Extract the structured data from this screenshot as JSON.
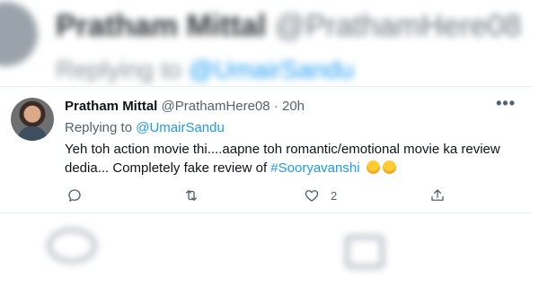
{
  "background_tweet": {
    "name": "Pratham Mittal",
    "handle": "@PrathamHere08",
    "replying_prefix": "Replying to",
    "replying_handle": "@UmairSandu"
  },
  "tweet": {
    "author_name": "Pratham Mittal",
    "author_handle": "@PrathamHere08",
    "separator": "·",
    "time": "20h",
    "more_label": "•••",
    "replying_prefix": "Replying to",
    "replying_handle": "@UmairSandu",
    "text_before_hashtag": "Yeh toh action movie thi....aapne toh romantic/emotional movie ka review dedia... Completely fake review of",
    "hashtag": "#Sooryavanshi",
    "emojis": [
      "face-with-tears-of-joy",
      "face-with-tears-of-joy"
    ],
    "actions": {
      "reply_icon": "reply-icon",
      "retweet_icon": "retweet-icon",
      "like_icon": "heart-icon",
      "like_count": "2",
      "share_icon": "share-icon"
    }
  },
  "colors": {
    "accent": "#1d9bf0",
    "secondary_text": "#536471",
    "primary_text": "#0f1419",
    "border": "#e6ecf0"
  }
}
